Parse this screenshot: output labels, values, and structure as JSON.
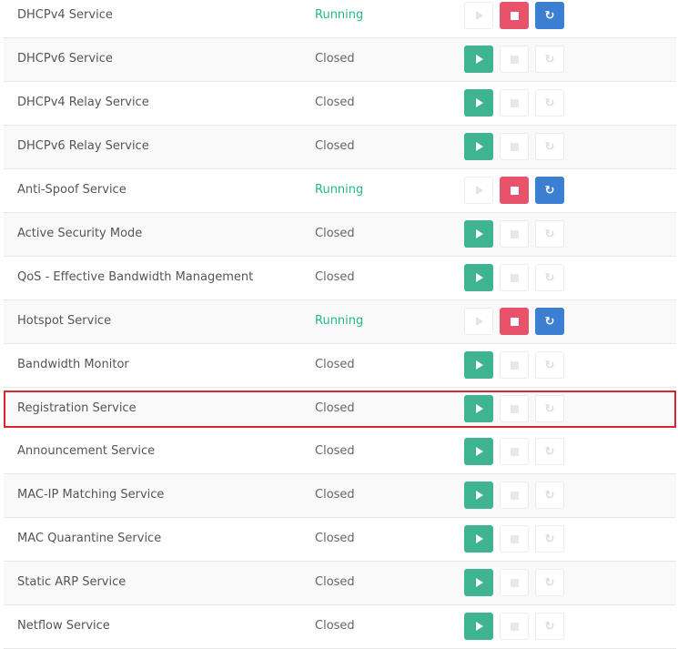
{
  "colors": {
    "running": "#26b68d",
    "start_button": "#3fb48e",
    "stop_button": "#e8536a",
    "restart_button": "#3a7fd1",
    "highlight_border": "#d9262c"
  },
  "icons": {
    "start": "play-icon",
    "stop": "stop-icon",
    "restart": "refresh-icon",
    "restart_glyph": "↻"
  },
  "services": [
    {
      "name": "DHCPv4 Service",
      "status": "Running",
      "running": true
    },
    {
      "name": "DHCPv6 Service",
      "status": "Closed",
      "running": false
    },
    {
      "name": "DHCPv4 Relay Service",
      "status": "Closed",
      "running": false
    },
    {
      "name": "DHCPv6 Relay Service",
      "status": "Closed",
      "running": false
    },
    {
      "name": "Anti-Spoof Service",
      "status": "Running",
      "running": true
    },
    {
      "name": "Active Security Mode",
      "status": "Closed",
      "running": false
    },
    {
      "name": "QoS - Effective Bandwidth Management",
      "status": "Closed",
      "running": false
    },
    {
      "name": "Hotspot Service",
      "status": "Running",
      "running": true
    },
    {
      "name": "Bandwidth Monitor",
      "status": "Closed",
      "running": false
    },
    {
      "name": "Registration Service",
      "status": "Closed",
      "running": false,
      "highlighted": true
    },
    {
      "name": "Announcement Service",
      "status": "Closed",
      "running": false
    },
    {
      "name": "MAC-IP Matching Service",
      "status": "Closed",
      "running": false
    },
    {
      "name": "MAC Quarantine Service",
      "status": "Closed",
      "running": false
    },
    {
      "name": "Static ARP Service",
      "status": "Closed",
      "running": false
    },
    {
      "name": "Netflow Service",
      "status": "Closed",
      "running": false
    }
  ]
}
